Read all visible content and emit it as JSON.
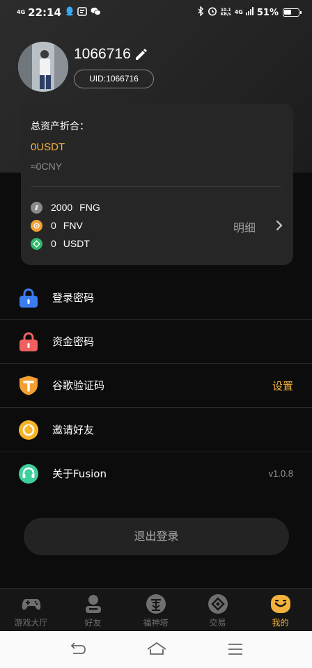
{
  "status_bar": {
    "network": "4G",
    "time": "22:14",
    "net_speed_value": "10.1",
    "net_speed_unit": "KB/s",
    "signal_label": "4G",
    "battery_text": "51%",
    "battery_level": 0.51
  },
  "profile": {
    "username": "1066716",
    "uid_label": "UID:1066716"
  },
  "assets": {
    "title": "总资产折合：",
    "total_usdt": "0USDT",
    "total_cny": "≈0CNY",
    "detail_label": "明细",
    "coins": [
      {
        "amount": "2000",
        "symbol": "FNG",
        "color": "#8a8a8a"
      },
      {
        "amount": "0",
        "symbol": "FNV",
        "color": "#f3a032"
      },
      {
        "amount": "0",
        "symbol": "USDT",
        "color": "#2fb86b"
      }
    ]
  },
  "menu": {
    "login_password": {
      "label": "登录密码",
      "icon": "lock-icon",
      "color": "#3b7cf0"
    },
    "fund_password": {
      "label": "资金密码",
      "icon": "lock-icon",
      "color": "#f06060"
    },
    "google_auth": {
      "label": "谷歌验证码",
      "value": "设置",
      "icon": "shield-icon",
      "color": "#f3a032"
    },
    "invite": {
      "label": "邀请好友",
      "icon": "invite-icon",
      "color": "#f5b42a"
    },
    "about": {
      "label": "关于Fusion",
      "version": "v1.0.8",
      "icon": "headset-icon",
      "color": "#3fcf9c"
    }
  },
  "logout_label": "退出登录",
  "tabs": [
    {
      "label": "游戏大厅",
      "icon": "gamepad-icon"
    },
    {
      "label": "好友",
      "icon": "friend-icon"
    },
    {
      "label": "福神塔",
      "icon": "tower-icon"
    },
    {
      "label": "交易",
      "icon": "trade-icon"
    },
    {
      "label": "我的",
      "icon": "smile-icon",
      "active": true
    }
  ],
  "accent_color": "#f3b23c"
}
